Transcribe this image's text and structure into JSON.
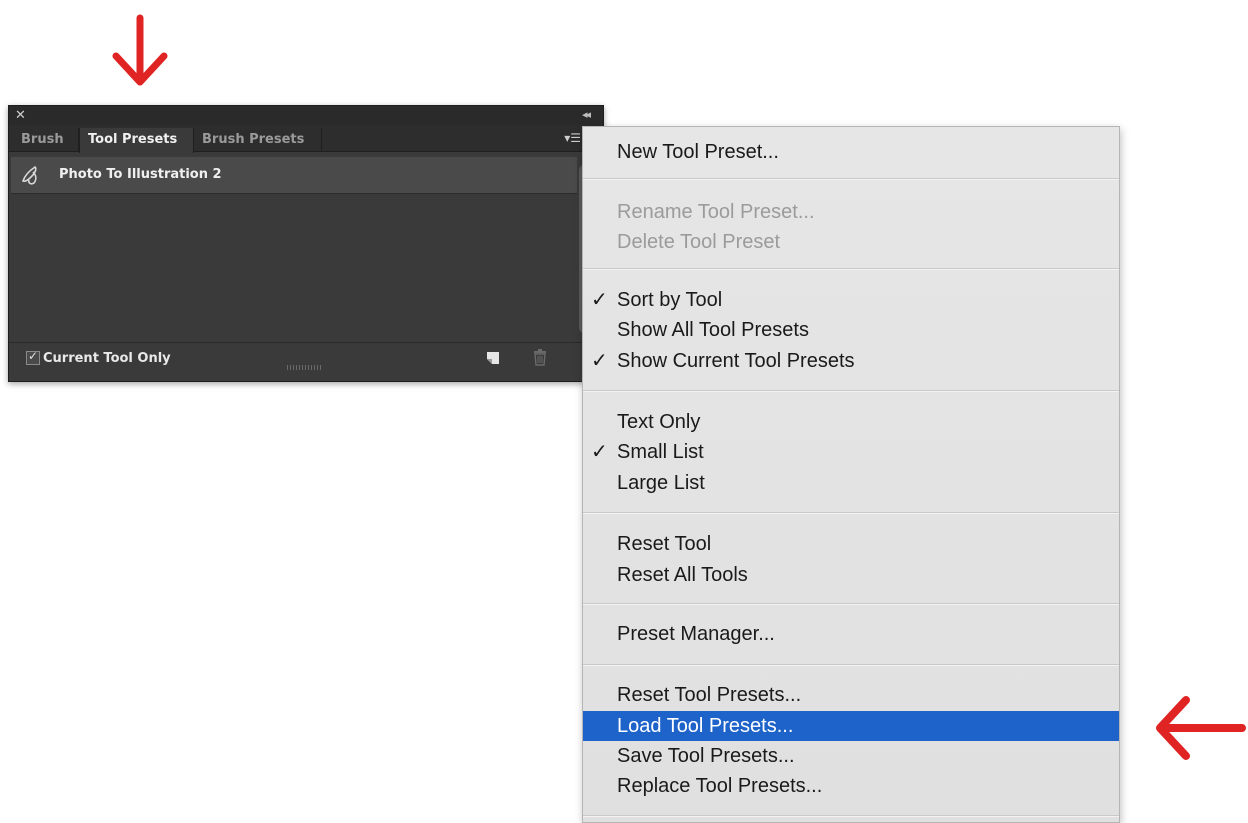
{
  "panel": {
    "close_icon": "close-icon",
    "collapse_icon": "double-chevron-left-icon",
    "tabs": [
      {
        "label": "Brush",
        "active": false
      },
      {
        "label": "Tool Presets",
        "active": true
      },
      {
        "label": "Brush Presets",
        "active": false
      }
    ],
    "menu_icon": "panel-menu-icon",
    "presets": [
      {
        "label": "Photo To Illustration 2",
        "icon": "brush-tool-icon"
      }
    ],
    "current_tool_only": {
      "label": "Current Tool Only",
      "checked": true
    },
    "new_preset_icon": "new-preset-icon",
    "delete_icon": "trash-icon"
  },
  "menu": {
    "highlight_color": "#1d63c9",
    "groups": [
      {
        "items": [
          {
            "label": "New Tool Preset...",
            "enabled": true,
            "checked": false
          }
        ]
      },
      {
        "items": [
          {
            "label": "Rename Tool Preset...",
            "enabled": false,
            "checked": false
          },
          {
            "label": "Delete Tool Preset",
            "enabled": false,
            "checked": false
          }
        ]
      },
      {
        "items": [
          {
            "label": "Sort by Tool",
            "enabled": true,
            "checked": true
          },
          {
            "label": "Show All Tool Presets",
            "enabled": true,
            "checked": false
          },
          {
            "label": "Show Current Tool Presets",
            "enabled": true,
            "checked": true
          }
        ]
      },
      {
        "items": [
          {
            "label": "Text Only",
            "enabled": true,
            "checked": false
          },
          {
            "label": "Small List",
            "enabled": true,
            "checked": true
          },
          {
            "label": "Large List",
            "enabled": true,
            "checked": false
          }
        ]
      },
      {
        "items": [
          {
            "label": "Reset Tool",
            "enabled": true,
            "checked": false
          },
          {
            "label": "Reset All Tools",
            "enabled": true,
            "checked": false
          }
        ]
      },
      {
        "items": [
          {
            "label": "Preset Manager...",
            "enabled": true,
            "checked": false
          }
        ]
      },
      {
        "items": [
          {
            "label": "Reset Tool Presets...",
            "enabled": true,
            "checked": false
          },
          {
            "label": "Load Tool Presets...",
            "enabled": true,
            "checked": false,
            "highlighted": true
          },
          {
            "label": "Save Tool Presets...",
            "enabled": true,
            "checked": false
          },
          {
            "label": "Replace Tool Presets...",
            "enabled": true,
            "checked": false
          }
        ]
      }
    ],
    "check_glyph": "✓"
  },
  "annotations": {
    "arrow_color": "#e02424",
    "arrows": [
      "arrow-down-icon",
      "arrow-left-icon"
    ]
  }
}
